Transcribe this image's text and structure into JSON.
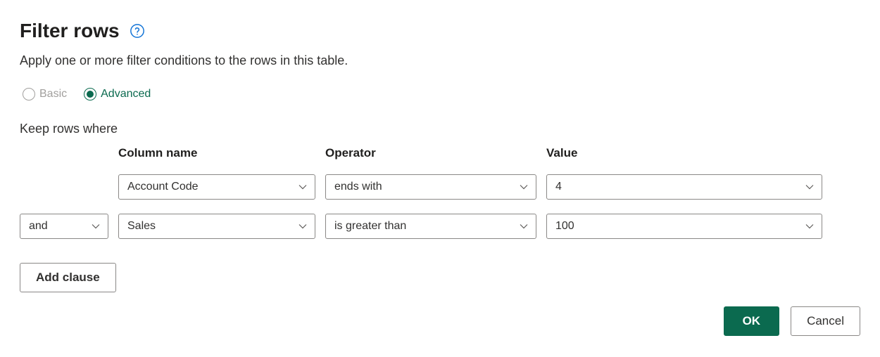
{
  "header": {
    "title": "Filter rows",
    "subtitle": "Apply one or more filter conditions to the rows in this table."
  },
  "mode": {
    "basic_label": "Basic",
    "advanced_label": "Advanced"
  },
  "filter": {
    "keep_rows_label": "Keep rows where",
    "columns": {
      "column_name": "Column name",
      "operator": "Operator",
      "value": "Value"
    },
    "clauses": [
      {
        "conjunction": "",
        "column": "Account Code",
        "operator": "ends with",
        "value": "4"
      },
      {
        "conjunction": "and",
        "column": "Sales",
        "operator": "is greater than",
        "value": "100"
      }
    ],
    "add_clause_label": "Add clause"
  },
  "footer": {
    "ok_label": "OK",
    "cancel_label": "Cancel"
  }
}
